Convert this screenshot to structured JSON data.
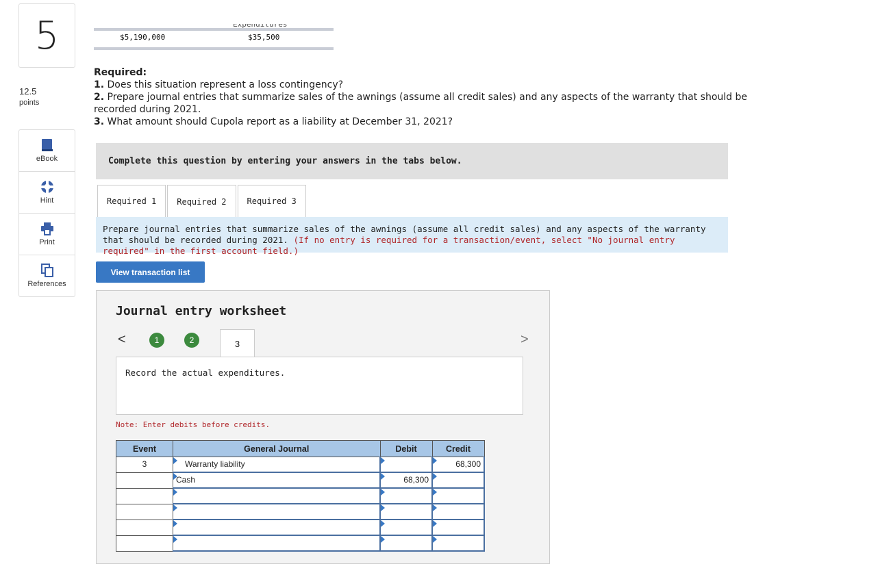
{
  "question": {
    "number": "5",
    "points_value": "12.5",
    "points_label": "points"
  },
  "side_tools": [
    {
      "label": "eBook",
      "icon": "book-icon"
    },
    {
      "label": "Hint",
      "icon": "lifebuoy-icon"
    },
    {
      "label": "Print",
      "icon": "printer-icon"
    },
    {
      "label": "References",
      "icon": "documents-icon"
    }
  ],
  "top_table": {
    "cut_header": "Expenditures",
    "value_left": "$5,190,000",
    "value_right": "$35,500"
  },
  "required": {
    "heading": "Required:",
    "items": [
      {
        "num": "1.",
        "text": "Does this situation represent a loss contingency?"
      },
      {
        "num": "2.",
        "text": "Prepare journal entries that summarize sales of the awnings (assume all credit sales) and any aspects of the warranty that should be recorded during 2021."
      },
      {
        "num": "3.",
        "text": "What amount should Cupola report as a liability at December 31, 2021?"
      }
    ]
  },
  "instruction_banner": "Complete this question by entering your answers in the tabs below.",
  "tabs": [
    {
      "label": "Required 1",
      "active": false
    },
    {
      "label": "Required 2",
      "active": true
    },
    {
      "label": "Required 3",
      "active": false
    }
  ],
  "prompt": {
    "text": "Prepare journal entries that summarize sales of the awnings (assume all credit sales) and any aspects of the warranty that should be recorded during 2021.",
    "red_text": "(If no entry is required for a transaction/event, select \"No journal entry required\" in the first account field.)"
  },
  "view_transactions_button": "View transaction list",
  "worksheet": {
    "title": "Journal entry worksheet",
    "prev_icon": "<",
    "next_icon": ">",
    "steps": [
      {
        "label": "1",
        "status": "complete"
      },
      {
        "label": "2",
        "status": "complete"
      },
      {
        "label": "3",
        "status": "current"
      }
    ],
    "description": "Record the actual expenditures.",
    "note": "Note: Enter debits before credits.",
    "table": {
      "headers": [
        "Event",
        "General Journal",
        "Debit",
        "Credit"
      ],
      "rows": [
        {
          "event": "3",
          "account": "Warranty liability",
          "indent": true,
          "debit": "",
          "credit": "68,300"
        },
        {
          "event": "",
          "account": "Cash",
          "indent": false,
          "debit": "68,300",
          "credit": ""
        },
        {
          "event": "",
          "account": "",
          "indent": false,
          "debit": "",
          "credit": ""
        },
        {
          "event": "",
          "account": "",
          "indent": false,
          "debit": "",
          "credit": ""
        },
        {
          "event": "",
          "account": "",
          "indent": false,
          "debit": "",
          "credit": ""
        },
        {
          "event": "",
          "account": "",
          "indent": false,
          "debit": "",
          "credit": ""
        }
      ]
    }
  }
}
